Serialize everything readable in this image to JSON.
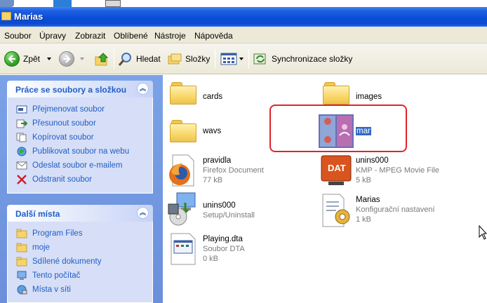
{
  "window": {
    "title": "Marias"
  },
  "menu": [
    "Soubor",
    "Úpravy",
    "Zobrazit",
    "Oblíbené",
    "Nástroje",
    "Nápověda"
  ],
  "toolbar": {
    "back": "Zpět",
    "search": "Hledat",
    "folders": "Složky",
    "sync": "Synchronizace složky"
  },
  "tasks_panel": {
    "title": "Práce se soubory a složkou",
    "collapse": "︽",
    "items": [
      {
        "label": "Přejmenovat soubor",
        "icon": "rename-icon"
      },
      {
        "label": "Přesunout soubor",
        "icon": "move-icon"
      },
      {
        "label": "Kopírovat soubor",
        "icon": "copy-icon"
      },
      {
        "label": "Publikovat soubor na webu",
        "icon": "publish-web-icon"
      },
      {
        "label": "Odeslat soubor e-mailem",
        "icon": "email-icon"
      },
      {
        "label": "Odstranit soubor",
        "icon": "delete-icon"
      }
    ]
  },
  "places_panel": {
    "title": "Další místa",
    "collapse": "︽",
    "items": [
      {
        "label": "Program Files",
        "icon": "folder-icon"
      },
      {
        "label": "moje",
        "icon": "folder-icon"
      },
      {
        "label": "Sdílené dokumenty",
        "icon": "folder-icon"
      },
      {
        "label": "Tento počítač",
        "icon": "computer-icon"
      },
      {
        "label": "Místa v síti",
        "icon": "network-icon"
      }
    ]
  },
  "files": [
    {
      "name": "cards",
      "type": "",
      "size": "",
      "icon": "folder-icon"
    },
    {
      "name": "images",
      "type": "",
      "size": "",
      "icon": "folder-icon"
    },
    {
      "name": "wavs",
      "type": "",
      "size": "",
      "icon": "folder-icon"
    },
    {
      "name": "mar",
      "type": "",
      "size": "",
      "icon": "card-image-icon",
      "selected": true
    },
    {
      "name": "pravidla",
      "type": "Firefox Document",
      "size": "77 kB",
      "icon": "firefox-icon"
    },
    {
      "name": "unins000",
      "type": "KMP - MPEG Movie File",
      "size": "5 kB",
      "icon": "dat-file-icon"
    },
    {
      "name": "unins000",
      "type": "Setup/Uninstall",
      "size": "",
      "icon": "uninstall-icon"
    },
    {
      "name": "Marias",
      "type": "Konfigurační nastavení",
      "size": "1 kB",
      "icon": "config-file-icon"
    },
    {
      "name": "Playing.dta",
      "type": "Soubor DTA",
      "size": "0 kB",
      "icon": "dta-file-icon"
    }
  ],
  "dat_label": "DAT",
  "colors": {
    "titlebar": "#0a4dd8",
    "taskpane": "#6b8fdc",
    "link": "#215dc6",
    "selection": "#316ac5",
    "highlight_frame": "#e0232b"
  }
}
